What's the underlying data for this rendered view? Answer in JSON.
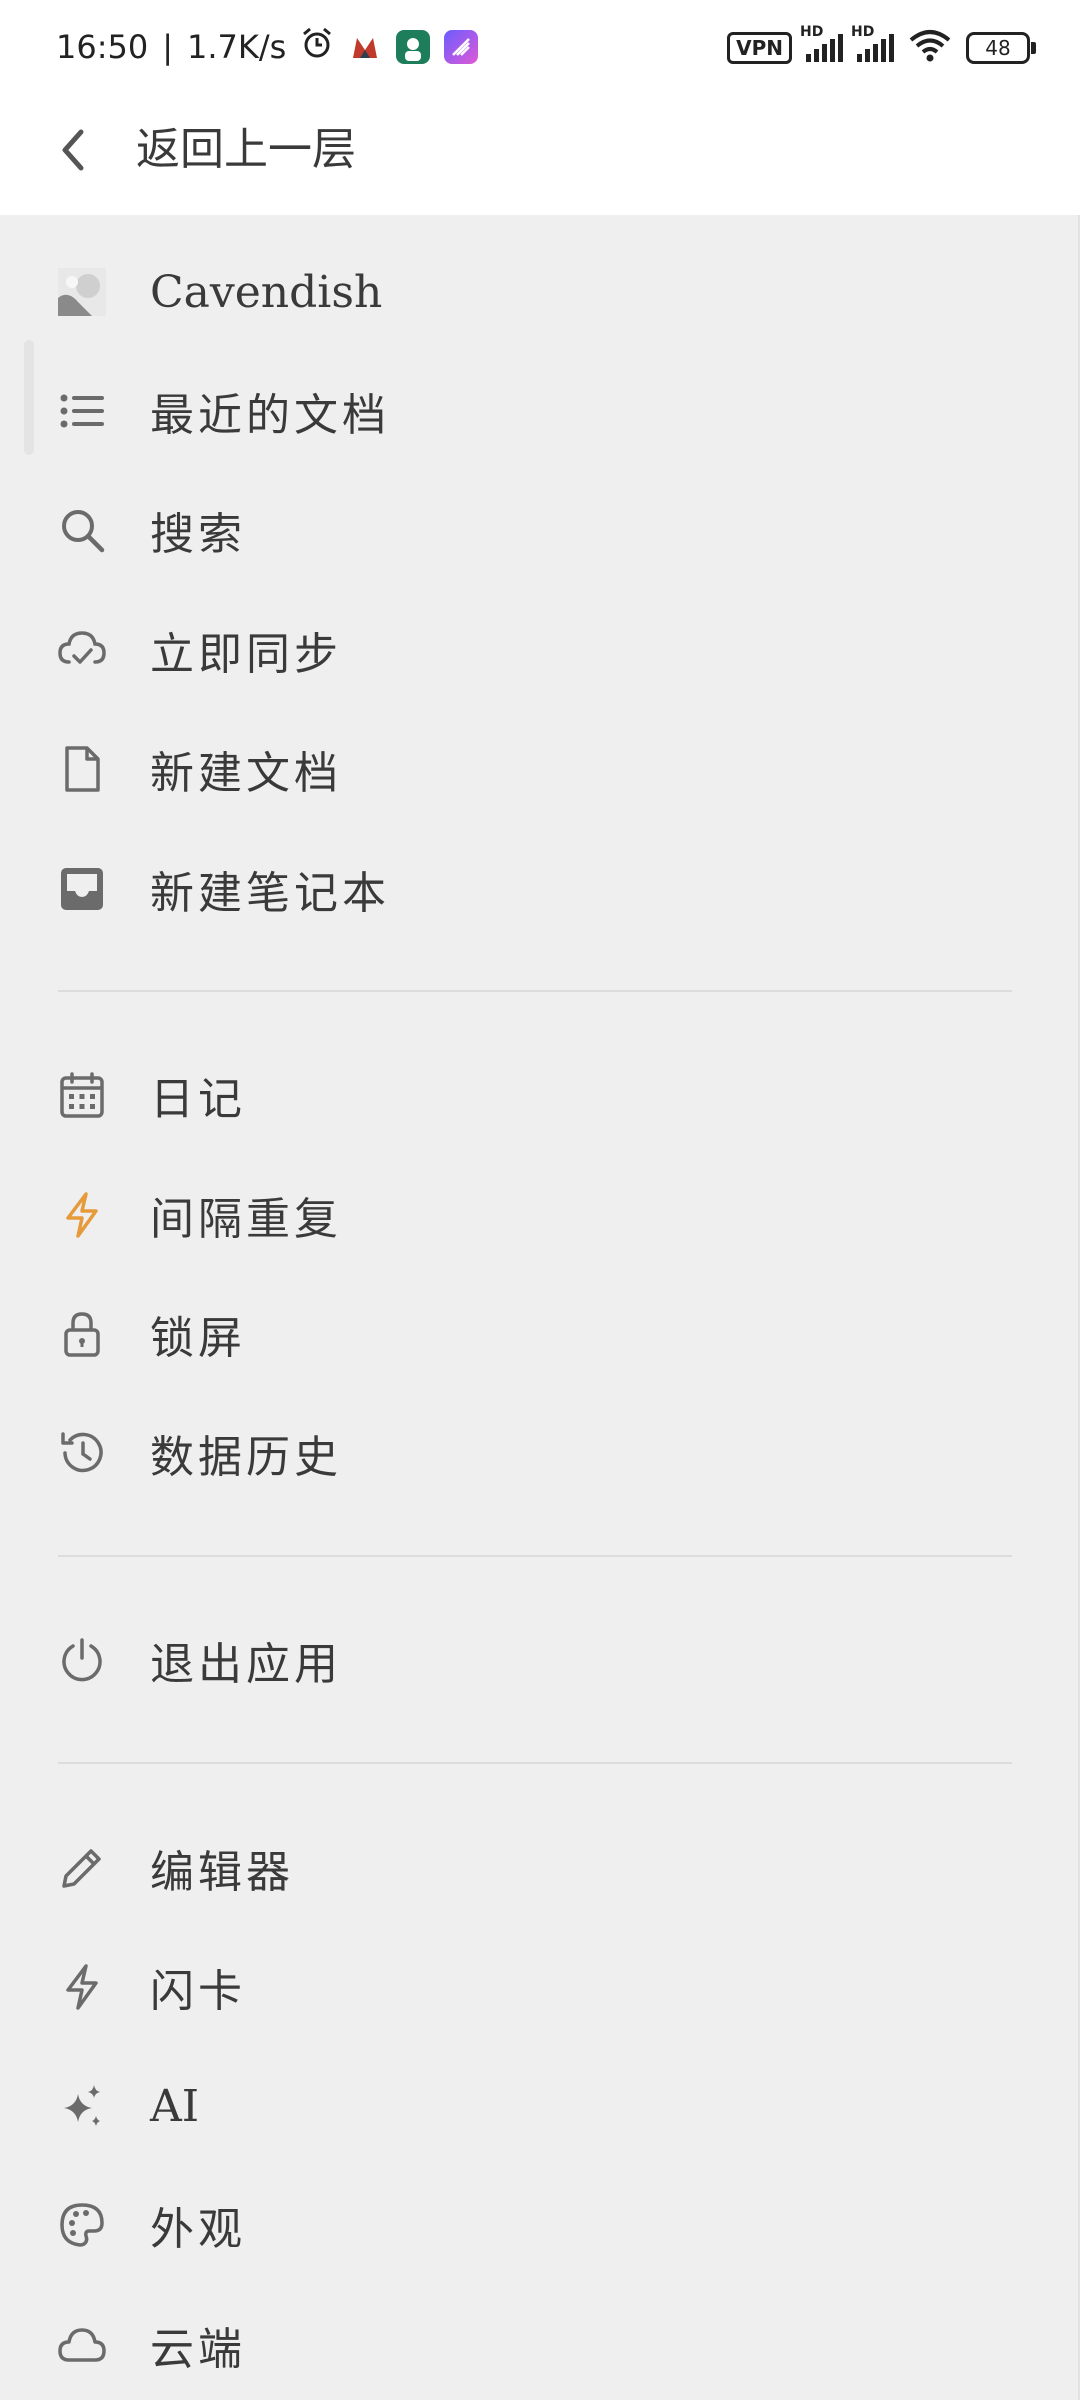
{
  "status_bar": {
    "time": "16:50",
    "net_speed": "1.7K/s",
    "vpn": "VPN",
    "hd1": "HD",
    "hd2": "HD",
    "battery": "48"
  },
  "header": {
    "back_icon": "chevron-left-icon",
    "title": "返回上一层"
  },
  "menu": {
    "account": {
      "label": "Cavendish",
      "icon": "avatar"
    },
    "group1": [
      {
        "label": "最近的文档",
        "icon": "list-icon"
      },
      {
        "label": "搜索",
        "icon": "search-icon"
      },
      {
        "label": "立即同步",
        "icon": "cloud-sync-icon"
      },
      {
        "label": "新建文档",
        "icon": "file-icon"
      },
      {
        "label": "新建笔记本",
        "icon": "inbox-icon"
      }
    ],
    "group2": [
      {
        "label": "日记",
        "icon": "calendar-icon"
      },
      {
        "label": "间隔重复",
        "icon": "bolt-icon",
        "color": "#e69b3b"
      },
      {
        "label": "锁屏",
        "icon": "lock-icon"
      },
      {
        "label": "数据历史",
        "icon": "history-icon"
      }
    ],
    "group3": [
      {
        "label": "退出应用",
        "icon": "power-icon"
      }
    ],
    "group4": [
      {
        "label": "编辑器",
        "icon": "pencil-icon"
      },
      {
        "label": "闪卡",
        "icon": "bolt-icon"
      },
      {
        "label": "AI",
        "icon": "sparkles-icon"
      },
      {
        "label": "外观",
        "icon": "palette-icon"
      },
      {
        "label": "云端",
        "icon": "cloud-icon"
      }
    ]
  },
  "colors": {
    "background": "#efefef",
    "header_bg": "#ffffff",
    "text": "#3a3a3a",
    "icon": "#6b6b6b",
    "accent_bolt": "#e69b3b"
  }
}
